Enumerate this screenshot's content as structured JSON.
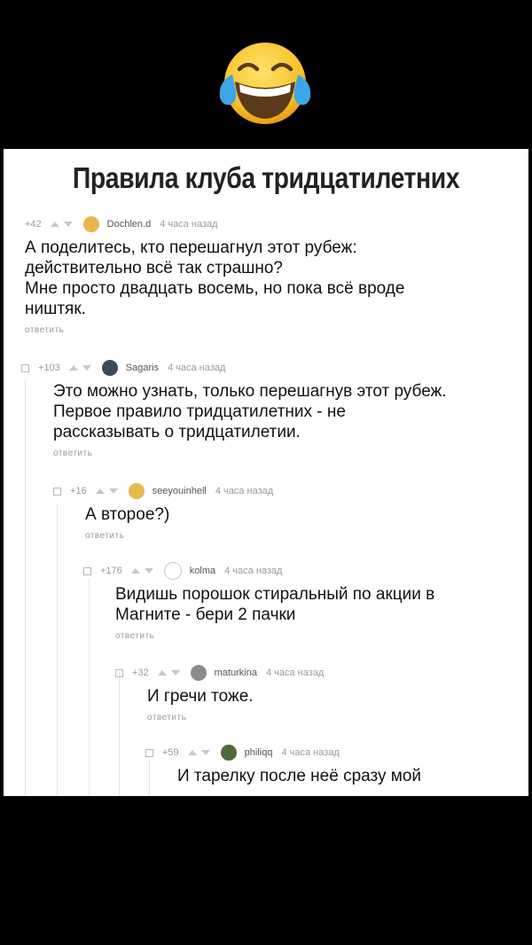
{
  "title": "Правила клуба тридцатилетних",
  "comments": [
    {
      "rating": "+42",
      "author": "Dochlen.d",
      "time": "4 часа назад",
      "text": "А поделитесь, кто перешагнул этот рубеж:\nдействительно всё так страшно?\nМне просто двадцать восемь, но пока всё вроде\nништяк.",
      "reply": "ответить",
      "avatar_color": "#e9b64a"
    },
    {
      "rating": "+103",
      "author": "Sagaris",
      "time": "4 часа назад",
      "text": "Это можно узнать, только перешагнув этот рубеж.\nПервое правило тридцатилетних - не\nрассказывать о тридцатилетии.",
      "reply": "ответить",
      "avatar_color": "#3c4a5a"
    },
    {
      "rating": "+16",
      "author": "seeyouinhell",
      "time": "4 часа назад",
      "text": "А второе?)",
      "reply": "ответить",
      "avatar_color": "#e6b94d"
    },
    {
      "rating": "+176",
      "author": "kolma",
      "time": "4 часа назад",
      "text": "Видишь порошок стиральный по акции в\nМагните - бери 2 пачки",
      "reply": "ответить",
      "avatar_color": "#ffffff"
    },
    {
      "rating": "+32",
      "author": "maturkina",
      "time": "4 часа назад",
      "text": "И гречи тоже.",
      "reply": "ответить",
      "avatar_color": "#8c8c8c"
    },
    {
      "rating": "+59",
      "author": "philiqq",
      "time": "4 часа назад",
      "text": "И тарелку после неё сразу мой",
      "reply": "",
      "avatar_color": "#4e6a3c"
    }
  ]
}
